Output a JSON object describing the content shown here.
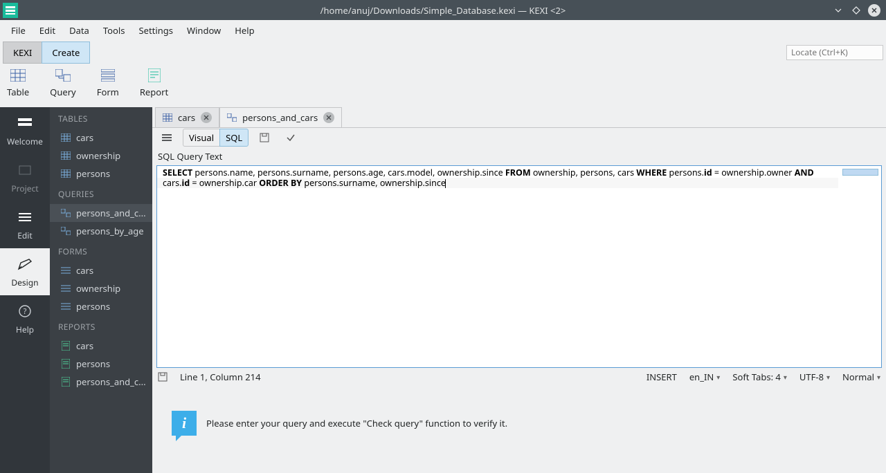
{
  "titlebar": {
    "title": "/home/anuj/Downloads/Simple_Database.kexi — KEXI <2>"
  },
  "menubar": [
    "File",
    "Edit",
    "Data",
    "Tools",
    "Settings",
    "Window",
    "Help"
  ],
  "mode_tabs": {
    "kexi": "KEXI",
    "create": "Create"
  },
  "locate_placeholder": "Locate (Ctrl+K)",
  "toolbar": {
    "table": "Table",
    "query": "Query",
    "form": "Form",
    "report": "Report"
  },
  "rail": {
    "welcome": "Welcome",
    "project": "Project",
    "edit": "Edit",
    "design": "Design",
    "help": "Help"
  },
  "project": {
    "tables_header": "TABLES",
    "tables": [
      "cars",
      "ownership",
      "persons"
    ],
    "queries_header": "QUERIES",
    "queries": [
      "persons_and_c...",
      "persons_by_age"
    ],
    "forms_header": "FORMS",
    "forms": [
      "cars",
      "ownership",
      "persons"
    ],
    "reports_header": "REPORTS",
    "reports": [
      "cars",
      "persons",
      "persons_and_c..."
    ]
  },
  "doc_tabs": {
    "cars": "cars",
    "pac": "persons_and_cars"
  },
  "view_toolbar": {
    "visual": "Visual",
    "sql": "SQL"
  },
  "query_label": "SQL Query Text",
  "sql": {
    "select": "SELECT",
    "cols": " persons.name, persons.surname, persons.age, cars.model, ownership.since ",
    "from": "FROM",
    "tables": " ownership, persons, cars ",
    "where": "WHERE",
    "cond1a": " persons.",
    "id1": "id",
    "cond1b": " = ownership.owner ",
    "and": "AND",
    "cond2a": " cars.",
    "id2": "id",
    "cond2b": " = ownership.car ",
    "orderby": "ORDER BY",
    "ordercols": " persons.surname, ownership.since"
  },
  "status": {
    "linecol": "Line 1, Column 214",
    "mode": "INSERT",
    "locale": "en_IN",
    "tabs": "Soft Tabs: 4",
    "encoding": "UTF-8",
    "normal": "Normal"
  },
  "info_message": "Please enter your query and execute \"Check query\" function to verify it."
}
